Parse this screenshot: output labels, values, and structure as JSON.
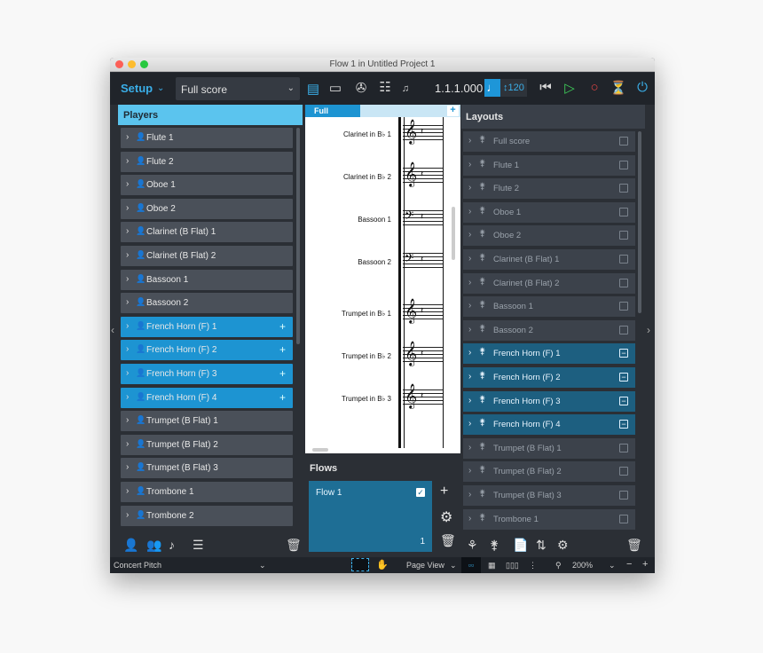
{
  "window": {
    "title": "Flow 1 in Untitled Project 1",
    "controls": [
      "close",
      "minimize",
      "zoom"
    ]
  },
  "toolbar": {
    "mode": "Setup",
    "layout_select": "Full score",
    "position": "1.1.1.000",
    "tempo": "120",
    "colors": {
      "accent": "#3aaee8",
      "selected": "#1d94d2"
    }
  },
  "players": {
    "title": "Players",
    "items": [
      {
        "label": "Flute 1",
        "selected": false
      },
      {
        "label": "Flute 2",
        "selected": false
      },
      {
        "label": "Oboe 1",
        "selected": false
      },
      {
        "label": "Oboe 2",
        "selected": false
      },
      {
        "label": "Clarinet (B Flat) 1",
        "selected": false
      },
      {
        "label": "Clarinet (B Flat) 2",
        "selected": false
      },
      {
        "label": "Bassoon 1",
        "selected": false
      },
      {
        "label": "Bassoon 2",
        "selected": false
      },
      {
        "label": "French Horn (F) 1",
        "selected": true
      },
      {
        "label": "French Horn (F) 2",
        "selected": true
      },
      {
        "label": "French Horn (F) 3",
        "selected": true
      },
      {
        "label": "French Horn (F) 4",
        "selected": true
      },
      {
        "label": "Trumpet (B Flat) 1",
        "selected": false
      },
      {
        "label": "Trumpet (B Flat) 2",
        "selected": false
      },
      {
        "label": "Trumpet (B Flat) 3",
        "selected": false
      },
      {
        "label": "Trombone 1",
        "selected": false
      },
      {
        "label": "Trombone 2",
        "selected": false
      }
    ]
  },
  "score": {
    "tab": "Full score",
    "staves": [
      {
        "label": "Clarinet in B♭ 1",
        "clef": "treble"
      },
      {
        "label": "Clarinet in B♭ 2",
        "clef": "treble"
      },
      {
        "label": "Bassoon 1",
        "clef": "bass"
      },
      {
        "label": "Bassoon 2",
        "clef": "bass"
      },
      {
        "label": "Trumpet in B♭ 1",
        "clef": "treble"
      },
      {
        "label": "Trumpet in B♭ 2",
        "clef": "treble"
      },
      {
        "label": "Trumpet in B♭ 3",
        "clef": "treble"
      }
    ]
  },
  "flows": {
    "title": "Flows",
    "card": {
      "name": "Flow 1",
      "number": "1",
      "checked": true
    }
  },
  "layouts": {
    "title": "Layouts",
    "items": [
      {
        "label": "Full score",
        "selected": false
      },
      {
        "label": "Flute 1",
        "selected": false
      },
      {
        "label": "Flute 2",
        "selected": false
      },
      {
        "label": "Oboe 1",
        "selected": false
      },
      {
        "label": "Oboe 2",
        "selected": false
      },
      {
        "label": "Clarinet (B Flat) 1",
        "selected": false
      },
      {
        "label": "Clarinet (B Flat) 2",
        "selected": false
      },
      {
        "label": "Bassoon 1",
        "selected": false
      },
      {
        "label": "Bassoon 2",
        "selected": false
      },
      {
        "label": "French Horn (F) 1",
        "selected": true
      },
      {
        "label": "French Horn (F) 2",
        "selected": true
      },
      {
        "label": "French Horn (F) 3",
        "selected": true
      },
      {
        "label": "French Horn (F) 4",
        "selected": true
      },
      {
        "label": "Trumpet (B Flat) 1",
        "selected": false
      },
      {
        "label": "Trumpet (B Flat) 2",
        "selected": false
      },
      {
        "label": "Trumpet (B Flat) 3",
        "selected": false
      },
      {
        "label": "Trombone 1",
        "selected": false
      }
    ]
  },
  "statusbar": {
    "concert_pitch": "Concert Pitch",
    "view": "Page View",
    "zoom": "200%"
  }
}
